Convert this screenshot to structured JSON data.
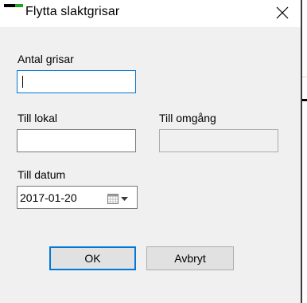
{
  "window": {
    "title": "Flytta slaktgrisar",
    "close_glyph": "✕"
  },
  "fields": {
    "antal_grisar": {
      "label": "Antal grisar",
      "value": ""
    },
    "till_lokal": {
      "label": "Till lokal",
      "value": ""
    },
    "till_omgang": {
      "label": "Till omgång",
      "value": ""
    },
    "till_datum": {
      "label": "Till datum",
      "value": "2017-01-20"
    }
  },
  "buttons": {
    "ok": "OK",
    "cancel": "Avbryt"
  },
  "colors": {
    "focus": "#0078d7",
    "dialog_bg": "#f0f0f0",
    "icon_green": "#1fa31f"
  },
  "icons": {
    "app": "app-icon",
    "close": "close-icon",
    "calendar": "calendar-icon",
    "dropdown": "chevron-down-icon"
  }
}
